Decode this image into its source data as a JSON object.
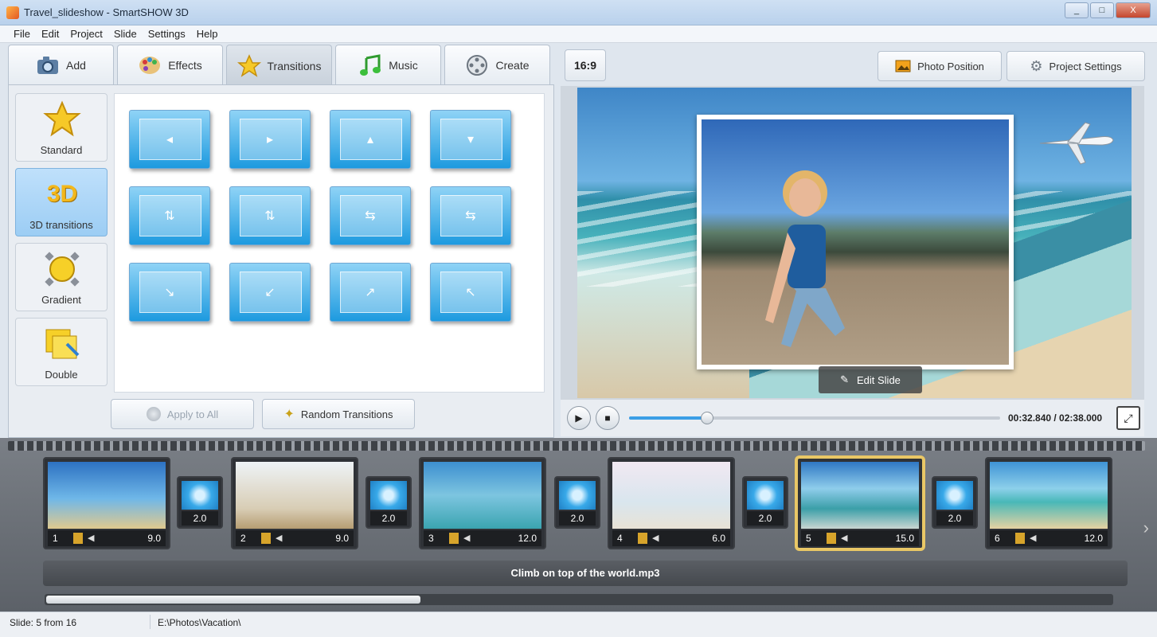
{
  "window": {
    "title": "Travel_slideshow - SmartSHOW 3D",
    "controls": [
      "_",
      "□",
      "X"
    ]
  },
  "menu": [
    "File",
    "Edit",
    "Project",
    "Slide",
    "Settings",
    "Help"
  ],
  "tabs": [
    {
      "label": "Add",
      "icon": "camera-icon"
    },
    {
      "label": "Effects",
      "icon": "palette-icon"
    },
    {
      "label": "Transitions",
      "icon": "star-icon",
      "active": true
    },
    {
      "label": "Music",
      "icon": "music-note-icon"
    },
    {
      "label": "Create",
      "icon": "film-reel-icon"
    }
  ],
  "categories": [
    {
      "label": "Standard",
      "icon": "star-icon"
    },
    {
      "label": "3D transitions",
      "icon": "3d-icon",
      "badge": "3D",
      "active": true
    },
    {
      "label": "Gradient",
      "icon": "gradient-icon"
    },
    {
      "label": "Double",
      "icon": "notes-icon"
    }
  ],
  "transitions_grid": {
    "rows": 3,
    "cols": 4,
    "arrows": [
      "◂",
      "▸",
      "▴",
      "▾",
      "⇅",
      "⇅",
      "⇆",
      "⇆",
      "↘",
      "↙",
      "↗",
      "↖"
    ]
  },
  "buttons": {
    "apply_to_all": "Apply to All",
    "random_transitions": "Random Transitions",
    "photo_position": "Photo Position",
    "project_settings": "Project Settings",
    "aspect_ratio": "16:9",
    "edit_slide": "Edit Slide"
  },
  "player": {
    "time_current": "00:32.840",
    "time_total": "02:38.000",
    "time_display": "00:32.840 / 02:38.000",
    "progress": 0.21
  },
  "timeline": {
    "slides": [
      {
        "num": "1",
        "duration": "9.0"
      },
      {
        "num": "2",
        "duration": "9.0"
      },
      {
        "num": "3",
        "duration": "12.0"
      },
      {
        "num": "4",
        "duration": "6.0"
      },
      {
        "num": "5",
        "duration": "15.0",
        "selected": true
      },
      {
        "num": "6",
        "duration": "12.0"
      }
    ],
    "transitions": [
      "2.0",
      "2.0",
      "2.0",
      "2.0",
      "2.0"
    ],
    "music_track": "Climb on top of the world.mp3"
  },
  "status": {
    "slide_info": "Slide: 5 from 16",
    "path": "E:\\Photos\\Vacation\\"
  },
  "colors": {
    "accent": "#3a9ee6",
    "selected_slide": "#e9c766",
    "transition_tile": "#1d9adf"
  }
}
